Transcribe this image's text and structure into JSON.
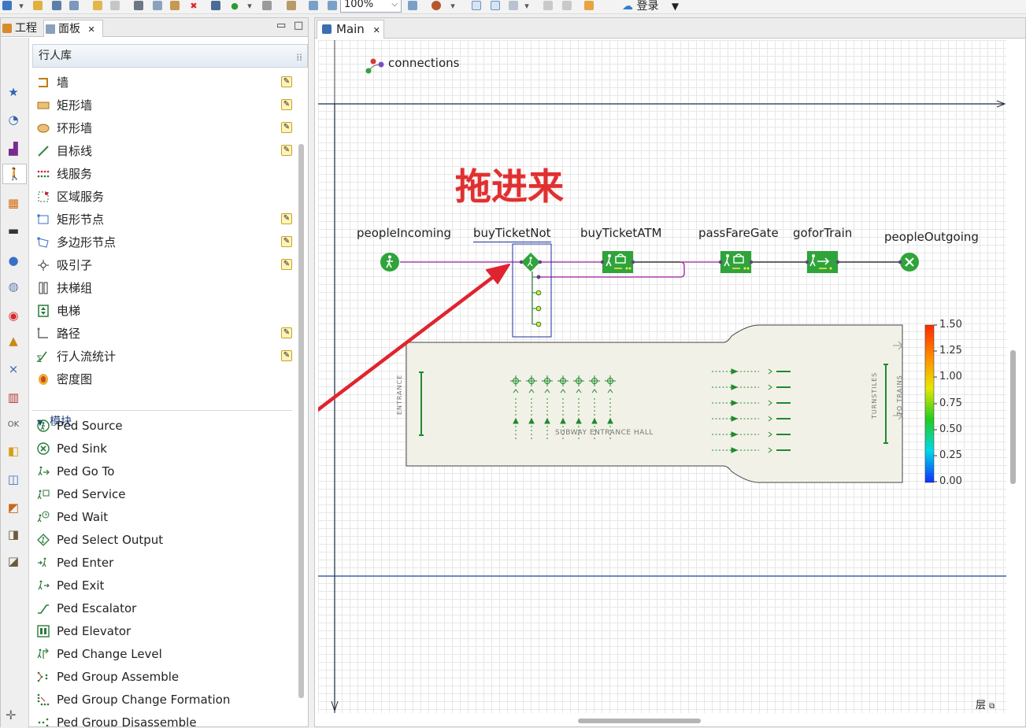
{
  "toolbar": {
    "zoom": "100%",
    "login_label": "登录"
  },
  "left_panel": {
    "tabs": [
      {
        "label": "工程"
      },
      {
        "label": "面板",
        "close": "✕"
      }
    ],
    "window_controls": {
      "minimize": "▭",
      "maximize": "□"
    },
    "palette_title": "行人库",
    "space_items": [
      {
        "label": "墙",
        "editable": true
      },
      {
        "label": "矩形墙",
        "editable": true
      },
      {
        "label": "环形墙",
        "editable": true
      },
      {
        "label": "目标线",
        "editable": true
      },
      {
        "label": "线服务",
        "editable": false
      },
      {
        "label": "区域服务",
        "editable": false
      },
      {
        "label": "矩形节点",
        "editable": true
      },
      {
        "label": "多边形节点",
        "editable": true
      },
      {
        "label": "吸引子",
        "editable": true
      },
      {
        "label": "扶梯组",
        "editable": false
      },
      {
        "label": "电梯",
        "editable": false
      },
      {
        "label": "路径",
        "editable": true
      },
      {
        "label": "行人流统计",
        "editable": true
      },
      {
        "label": "密度图",
        "editable": false
      }
    ],
    "modules_section_label": "模块",
    "module_items": [
      "Ped Source",
      "Ped Sink",
      "Ped Go To",
      "Ped Service",
      "Ped Wait",
      "Ped Select Output",
      "Ped Enter",
      "Ped Exit",
      "Ped Escalator",
      "Ped Elevator",
      "Ped Change Level",
      "Ped Group Assemble",
      "Ped Group Change Formation",
      "Ped Group Disassemble"
    ]
  },
  "editor": {
    "tab_label": "Main",
    "tab_close": "✕",
    "connections_label": "connections",
    "annotation_text": "拖进来",
    "flow_blocks": [
      {
        "name": "peopleIncoming",
        "kind": "source"
      },
      {
        "name": "buyTicketNot",
        "kind": "select-output"
      },
      {
        "name": "buyTicketATM",
        "kind": "service"
      },
      {
        "name": "passFareGate",
        "kind": "service"
      },
      {
        "name": "goforTrain",
        "kind": "goto"
      },
      {
        "name": "peopleOutgoing",
        "kind": "sink"
      }
    ],
    "floor_plan": {
      "entrance_label": "ENTRANCE",
      "hall_label": "SUBWAY ENTRANCE HALL",
      "turnstiles_label": "TURNSTILES",
      "to_trains_label": "TO TRAINS"
    },
    "density_legend": {
      "ticks": [
        "1.50",
        "1.25",
        "1.00",
        "0.75",
        "0.50",
        "0.25",
        "0.00"
      ]
    },
    "layers_label": "层"
  },
  "colors": {
    "accent_blue": "#1c4e9c",
    "flow_green": "#2ea43a",
    "connector_purple": "#a020a0",
    "annotation_red": "#e03030",
    "arrow_red": "#e0242f"
  }
}
